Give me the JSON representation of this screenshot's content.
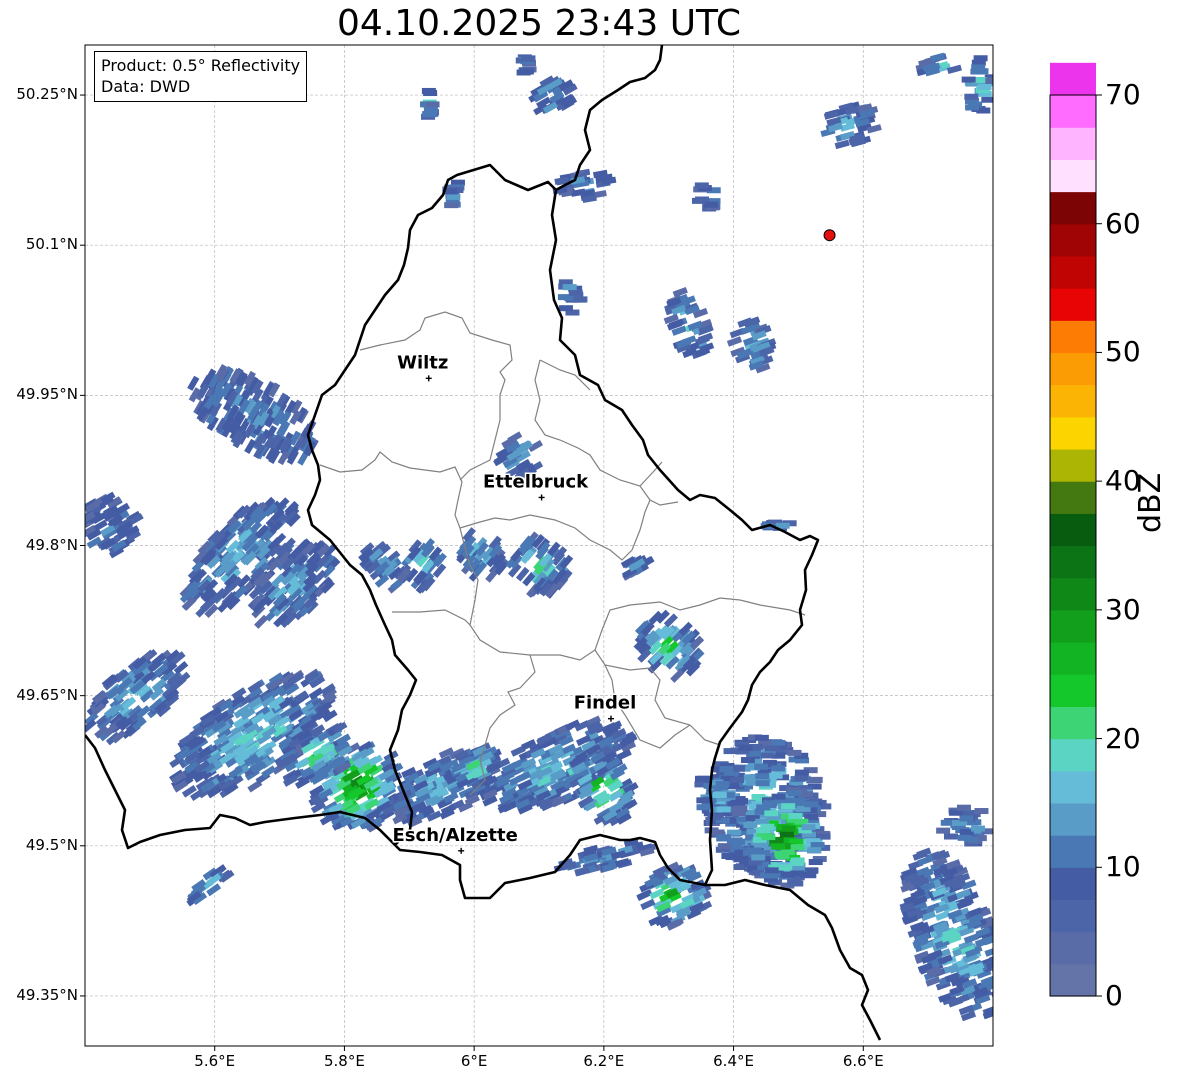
{
  "title": "04.10.2025 23:43 UTC",
  "info": {
    "product": "Product: 0.5° Reflectivity",
    "data": "Data: DWD"
  },
  "axes": {
    "lat_ticks": [
      "50.25°N",
      "50.1°N",
      "49.95°N",
      "49.8°N",
      "49.65°N",
      "49.5°N",
      "49.35°N"
    ],
    "lon_ticks": [
      "5.6°E",
      "5.8°E",
      "6°E",
      "6.2°E",
      "6.4°E",
      "6.6°E"
    ],
    "lon_range": [
      5.4,
      6.8
    ],
    "lat_range": [
      49.3,
      50.3
    ]
  },
  "cities": [
    {
      "name": "Wiltz",
      "lon": 5.93,
      "lat": 49.967
    },
    {
      "name": "Ettelbruck",
      "lon": 6.104,
      "lat": 49.848
    },
    {
      "name": "Findel",
      "lon": 6.211,
      "lat": 49.627
    },
    {
      "name": "Esch/Alzette",
      "lon": 5.98,
      "lat": 49.495
    }
  ],
  "radar_site": {
    "lon": 6.548,
    "lat": 50.11,
    "color": "#e41010"
  },
  "colorbar": {
    "label": "dBZ",
    "ticks": [
      "0",
      "10",
      "20",
      "30",
      "40",
      "50",
      "60",
      "70"
    ],
    "colors": [
      "#6474a8",
      "#5a6ca8",
      "#4c64a8",
      "#445ca4",
      "#4a78b4",
      "#5a9cc8",
      "#64bcd8",
      "#5cd4c4",
      "#3cd474",
      "#14c82c",
      "#12b424",
      "#12a01c",
      "#108818",
      "#0c7414",
      "#085c10",
      "#447810",
      "#acb404",
      "#fcd400",
      "#fcb404",
      "#fc9c04",
      "#fc7c04",
      "#e80404",
      "#c00404",
      "#a00404",
      "#7c0404",
      "#ffe0ff",
      "#ffb4ff",
      "#ff6cff",
      "#ec34ec"
    ]
  },
  "echoes": [
    {
      "lon": 5.66,
      "lat": 49.93,
      "rx": 0.05,
      "ry": 0.07,
      "rot": -60,
      "level": 5
    },
    {
      "lon": 5.44,
      "lat": 49.82,
      "rx": 0.04,
      "ry": 0.03,
      "rot": -30,
      "level": 5
    },
    {
      "lon": 5.64,
      "lat": 49.79,
      "rx": 0.11,
      "ry": 0.035,
      "rot": -45,
      "level": 6
    },
    {
      "lon": 5.72,
      "lat": 49.76,
      "rx": 0.08,
      "ry": 0.03,
      "rot": -45,
      "level": 6
    },
    {
      "lon": 5.48,
      "lat": 49.65,
      "rx": 0.09,
      "ry": 0.03,
      "rot": -40,
      "level": 6
    },
    {
      "lon": 5.66,
      "lat": 49.61,
      "rx": 0.14,
      "ry": 0.045,
      "rot": -33,
      "level": 7
    },
    {
      "lon": 5.82,
      "lat": 49.56,
      "rx": 0.07,
      "ry": 0.045,
      "rot": -30,
      "level": 12
    },
    {
      "lon": 5.76,
      "lat": 49.59,
      "rx": 0.06,
      "ry": 0.025,
      "rot": -30,
      "level": 9
    },
    {
      "lon": 5.59,
      "lat": 49.46,
      "rx": 0.035,
      "ry": 0.01,
      "rot": -35,
      "level": 7
    },
    {
      "lon": 5.86,
      "lat": 49.78,
      "rx": 0.025,
      "ry": 0.025,
      "rot": -40,
      "level": 5
    },
    {
      "lon": 5.92,
      "lat": 49.78,
      "rx": 0.035,
      "ry": 0.02,
      "rot": -50,
      "level": 7
    },
    {
      "lon": 6.01,
      "lat": 49.79,
      "rx": 0.03,
      "ry": 0.025,
      "rot": -50,
      "level": 6
    },
    {
      "lon": 6.1,
      "lat": 49.78,
      "rx": 0.04,
      "ry": 0.03,
      "rot": -50,
      "level": 8
    },
    {
      "lon": 6.07,
      "lat": 49.89,
      "rx": 0.03,
      "ry": 0.02,
      "rot": -30,
      "level": 5
    },
    {
      "lon": 6.25,
      "lat": 49.78,
      "rx": 0.02,
      "ry": 0.01,
      "rot": -30,
      "level": 5
    },
    {
      "lon": 6.3,
      "lat": 49.7,
      "rx": 0.04,
      "ry": 0.035,
      "rot": -45,
      "level": 9
    },
    {
      "lon": 5.95,
      "lat": 49.56,
      "rx": 0.09,
      "ry": 0.03,
      "rot": -25,
      "level": 6
    },
    {
      "lon": 6.13,
      "lat": 49.58,
      "rx": 0.12,
      "ry": 0.035,
      "rot": -25,
      "level": 7
    },
    {
      "lon": 6.2,
      "lat": 49.56,
      "rx": 0.04,
      "ry": 0.04,
      "rot": -30,
      "level": 11
    },
    {
      "lon": 6.21,
      "lat": 49.49,
      "rx": 0.08,
      "ry": 0.012,
      "rot": -15,
      "level": 5
    },
    {
      "lon": 6.31,
      "lat": 49.45,
      "rx": 0.05,
      "ry": 0.03,
      "rot": -25,
      "level": 11
    },
    {
      "lon": 6.45,
      "lat": 49.54,
      "rx": 0.09,
      "ry": 0.07,
      "rot": 0,
      "level": 7
    },
    {
      "lon": 6.48,
      "lat": 49.51,
      "rx": 0.06,
      "ry": 0.05,
      "rot": 0,
      "level": 13
    },
    {
      "lon": 6.38,
      "lat": 49.55,
      "rx": 0.035,
      "ry": 0.03,
      "rot": 0,
      "level": 6
    },
    {
      "lon": 6.74,
      "lat": 49.41,
      "rx": 0.06,
      "ry": 0.09,
      "rot": -20,
      "level": 7
    },
    {
      "lon": 6.76,
      "lat": 49.52,
      "rx": 0.04,
      "ry": 0.02,
      "rot": 0,
      "level": 5
    },
    {
      "lon": 6.47,
      "lat": 49.82,
      "rx": 0.02,
      "ry": 0.005,
      "rot": 0,
      "level": 5
    },
    {
      "lon": 6.33,
      "lat": 50.02,
      "rx": 0.025,
      "ry": 0.035,
      "rot": -20,
      "level": 7
    },
    {
      "lon": 6.43,
      "lat": 50.0,
      "rx": 0.03,
      "ry": 0.025,
      "rot": -20,
      "level": 6
    },
    {
      "lon": 6.36,
      "lat": 50.15,
      "rx": 0.015,
      "ry": 0.015,
      "rot": 0,
      "level": 5
    },
    {
      "lon": 6.17,
      "lat": 50.16,
      "rx": 0.04,
      "ry": 0.015,
      "rot": -10,
      "level": 5
    },
    {
      "lon": 6.12,
      "lat": 50.25,
      "rx": 0.03,
      "ry": 0.02,
      "rot": -30,
      "level": 5
    },
    {
      "lon": 6.15,
      "lat": 50.05,
      "rx": 0.015,
      "ry": 0.018,
      "rot": 0,
      "level": 5
    },
    {
      "lon": 6.58,
      "lat": 50.22,
      "rx": 0.04,
      "ry": 0.02,
      "rot": -15,
      "level": 6
    },
    {
      "lon": 6.72,
      "lat": 50.28,
      "rx": 0.03,
      "ry": 0.01,
      "rot": -15,
      "level": 7
    },
    {
      "lon": 6.78,
      "lat": 50.26,
      "rx": 0.02,
      "ry": 0.03,
      "rot": 0,
      "level": 7
    },
    {
      "lon": 5.93,
      "lat": 50.24,
      "rx": 0.006,
      "ry": 0.015,
      "rot": 0,
      "level": 7
    },
    {
      "lon": 5.97,
      "lat": 50.15,
      "rx": 0.01,
      "ry": 0.015,
      "rot": 0,
      "level": 5
    },
    {
      "lon": 6.08,
      "lat": 50.28,
      "rx": 0.006,
      "ry": 0.012,
      "rot": 0,
      "level": 5
    },
    {
      "lon": 6.0,
      "lat": 49.58,
      "rx": 0.04,
      "ry": 0.02,
      "rot": -25,
      "level": 8
    }
  ]
}
